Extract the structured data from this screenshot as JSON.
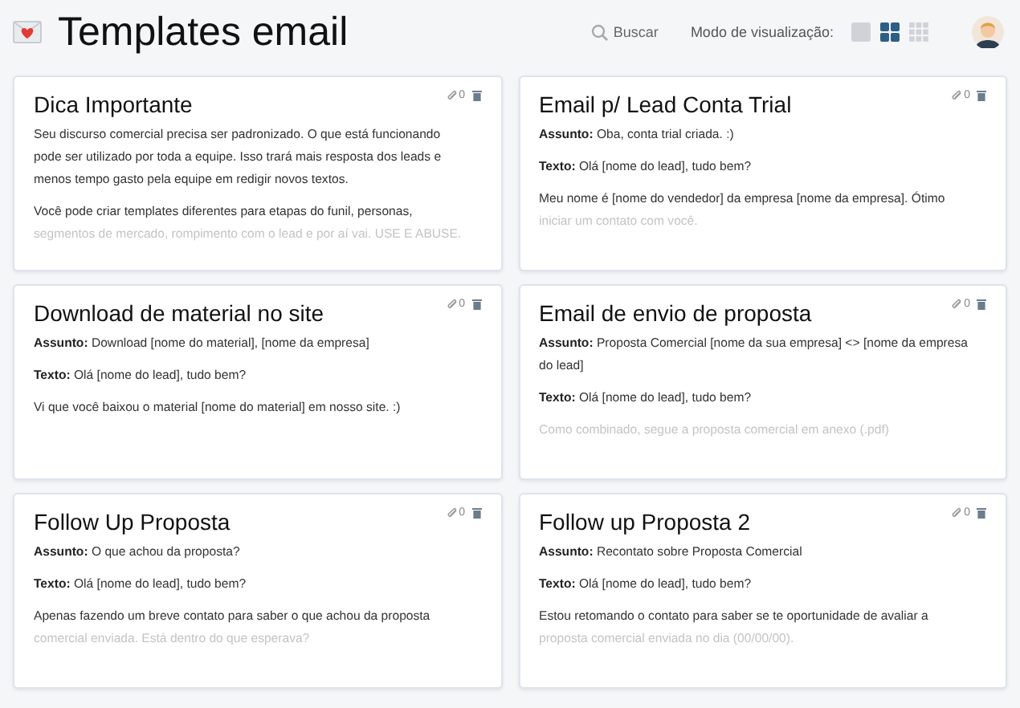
{
  "header": {
    "title": "Templates email",
    "search": {
      "label": "Buscar"
    },
    "view_mode": {
      "label": "Modo de visualização:",
      "options": [
        {
          "kind": "single",
          "selected": false
        },
        {
          "kind": "grid4",
          "selected": true
        },
        {
          "kind": "grid9",
          "selected": false
        }
      ]
    }
  },
  "templates": [
    {
      "title": "Dica Importante",
      "attachments": "0",
      "paragraphs": [
        {
          "lines": [
            {
              "text": "Seu discurso comercial precisa ser padronizado.  O que está funcionando",
              "faded": false
            },
            {
              "text": "pode ser utilizado por toda a equipe.  Isso trará mais resposta dos leads e",
              "faded": false
            },
            {
              "text": "menos tempo gasto pela equipe em redigir novos textos.",
              "faded": false
            }
          ]
        },
        {
          "lines": [
            {
              "text": "Você pode criar templates diferentes para etapas do funil, personas,",
              "faded": false
            },
            {
              "text": "segmentos de mercado, rompimento com o lead e por aí vai.  USE E ABUSE.",
              "faded": true
            }
          ]
        }
      ]
    },
    {
      "title": "Email p/ Lead Conta Trial",
      "attachments": "0",
      "paragraphs": [
        {
          "label": "Assunto:",
          "lines": [
            {
              "text": "Oba, conta trial criada.   :)",
              "faded": false
            }
          ]
        },
        {
          "label": "Texto:",
          "lines": [
            {
              "text": "Olá [nome do lead], tudo bem?",
              "faded": false
            }
          ]
        },
        {
          "lines": [
            {
              "text": "Meu nome é [nome do vendedor] da empresa [nome da empresa].  Ótimo",
              "faded": false
            },
            {
              "text": "iniciar um contato com você.",
              "faded": true
            }
          ]
        }
      ]
    },
    {
      "title": "Download de material no site",
      "attachments": "0",
      "paragraphs": [
        {
          "label": "Assunto:",
          "lines": [
            {
              "text": "Download [nome do material], [nome da empresa]",
              "faded": false
            }
          ]
        },
        {
          "label": "Texto:",
          "lines": [
            {
              "text": "Olá [nome do lead], tudo bem?",
              "faded": false
            }
          ]
        },
        {
          "lines": [
            {
              "text": "Vi que você baixou o material [nome do material] em nosso site.  :)",
              "faded": false
            }
          ]
        }
      ]
    },
    {
      "title": "Email de envio de proposta",
      "attachments": "0",
      "paragraphs": [
        {
          "label": "Assunto:",
          "lines": [
            {
              "text": "Proposta Comercial [nome da sua empresa] <> [nome da empresa",
              "faded": false
            },
            {
              "text": "do lead]",
              "faded": false
            }
          ]
        },
        {
          "label": "Texto:",
          "lines": [
            {
              "text": "Olá [nome do lead], tudo bem?",
              "faded": false
            }
          ]
        },
        {
          "lines": [
            {
              "text": "Como combinado, segue a proposta comercial em anexo (.pdf)",
              "faded": true
            }
          ]
        }
      ]
    },
    {
      "title": "Follow Up Proposta",
      "attachments": "0",
      "paragraphs": [
        {
          "label": "Assunto:",
          "lines": [
            {
              "text": "O que achou da proposta?",
              "faded": false
            }
          ]
        },
        {
          "label": "Texto:",
          "lines": [
            {
              "text": "Olá [nome do lead], tudo bem?",
              "faded": false
            }
          ]
        },
        {
          "lines": [
            {
              "text": "Apenas fazendo um breve contato para saber o que achou da proposta",
              "faded": false
            },
            {
              "text": "comercial enviada.  Está dentro do que esperava?",
              "faded": true
            }
          ]
        }
      ]
    },
    {
      "title": "Follow up Proposta 2",
      "attachments": "0",
      "paragraphs": [
        {
          "label": "Assunto:",
          "lines": [
            {
              "text": "Recontato sobre Proposta Comercial",
              "faded": false
            }
          ]
        },
        {
          "label": "Texto:",
          "lines": [
            {
              "text": "Olá [nome do lead], tudo bem?",
              "faded": false
            }
          ]
        },
        {
          "lines": [
            {
              "text": "Estou retomando o contato para saber se te oportunidade de avaliar a",
              "faded": false
            },
            {
              "text": "proposta comercial enviada no dia (00/00/00).",
              "faded": true
            }
          ]
        }
      ]
    }
  ]
}
